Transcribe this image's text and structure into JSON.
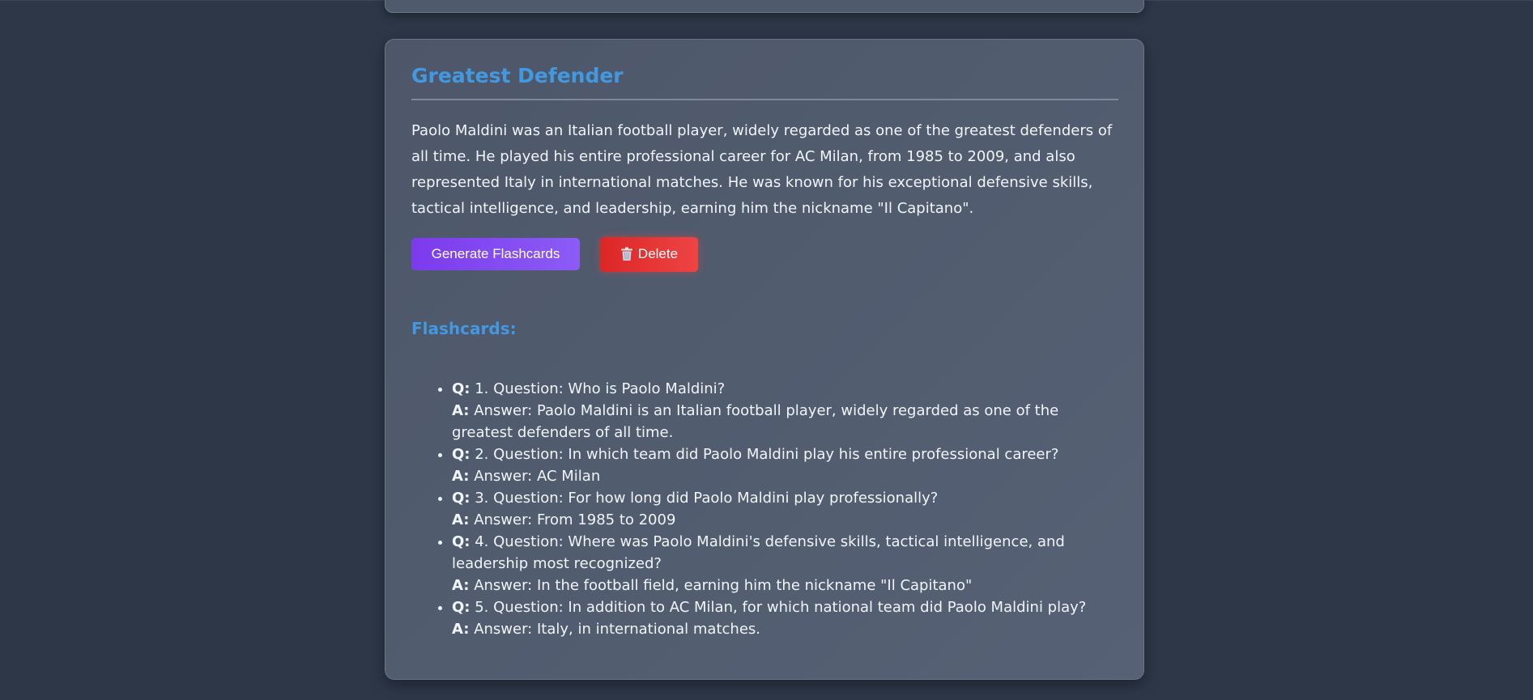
{
  "card": {
    "title": "Greatest Defender",
    "description": "Paolo Maldini was an Italian football player, widely regarded as one of the greatest defenders of all time. He played his entire professional career for AC Milan, from 1985 to 2009, and also represented Italy in international matches. He was known for his exceptional defensive skills, tactical intelligence, and leadership, earning him the nickname \"Il Capitano\".",
    "generate_label": "Generate Flashcards",
    "delete_label": "Delete",
    "delete_icon": "trash-icon"
  },
  "flashcards": {
    "heading": "Flashcards:",
    "q_label": "Q:",
    "a_label": "A:",
    "items": [
      {
        "question": "1. Question: Who is Paolo Maldini?",
        "answer": "Answer: Paolo Maldini is an Italian football player, widely regarded as one of the greatest defenders of all time."
      },
      {
        "question": "2. Question: In which team did Paolo Maldini play his entire professional career?",
        "answer": "Answer: AC Milan"
      },
      {
        "question": "3. Question: For how long did Paolo Maldini play professionally?",
        "answer": "Answer: From 1985 to 2009"
      },
      {
        "question": "4. Question: Where was Paolo Maldini's defensive skills, tactical intelligence, and leadership most recognized?",
        "answer": "Answer: In the football field, earning him the nickname \"Il Capitano\""
      },
      {
        "question": "5. Question: In addition to AC Milan, for which national team did Paolo Maldini play?",
        "answer": "Answer: Italy, in international matches."
      }
    ]
  },
  "colors": {
    "background": "#2d3748",
    "accent": "#4299e1",
    "generate_button": "#7c3aed",
    "delete_button": "#ef4444"
  }
}
